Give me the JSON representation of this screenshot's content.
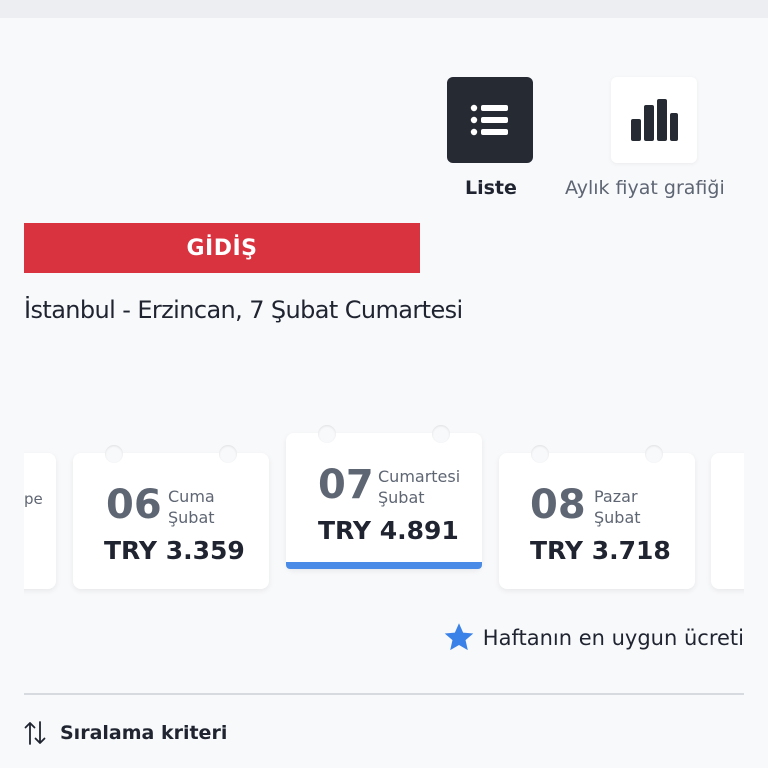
{
  "view_toggle": {
    "list_label": "Liste",
    "chart_label": "Aylık fiyat grafiği",
    "list_icon": "list-icon",
    "chart_icon": "bar-chart-icon"
  },
  "direction_label": "GİDİŞ",
  "route_text": "İstanbul - Erzincan, 7 Şubat Cumartesi",
  "date_cards": [
    {
      "partial_label": "pe"
    },
    {
      "day": "06",
      "weekday": "Cuma",
      "month": "Şubat",
      "price": "TRY 3.359",
      "selected": false
    },
    {
      "day": "07",
      "weekday": "Cumartesi",
      "month": "Şubat",
      "price": "TRY 4.891",
      "selected": true
    },
    {
      "day": "08",
      "weekday": "Pazar",
      "month": "Şubat",
      "price": "TRY 3.718",
      "selected": false
    },
    {
      "partial_label": ""
    }
  ],
  "best_price": {
    "text": "Haftanın en uygun ücreti",
    "icon": "star-icon"
  },
  "sort": {
    "label": "Sıralama kriteri",
    "icon": "sort-arrows-icon"
  },
  "colors": {
    "accent_red": "#da3340",
    "accent_blue": "#4a8be8",
    "star": "#3b82e8",
    "dark": "#262a33"
  }
}
